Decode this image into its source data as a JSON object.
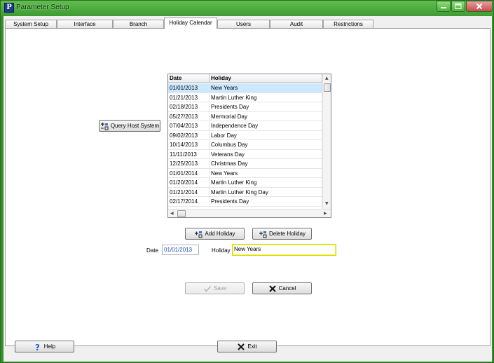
{
  "window": {
    "title": "Parameter Setup",
    "app_icon": "app-icon"
  },
  "tabs": [
    {
      "label": "System Setup"
    },
    {
      "label": "Interface"
    },
    {
      "label": "Branch"
    },
    {
      "label": "Holiday Calendar",
      "active": true
    },
    {
      "label": "Users"
    },
    {
      "label": "Audit"
    },
    {
      "label": "Restrictions"
    }
  ],
  "query_button": {
    "label": "Query Host System",
    "icon": "query-icon"
  },
  "grid": {
    "columns": {
      "date": "Date",
      "holiday": "Holiday"
    },
    "rows": [
      {
        "date": "01/01/2013",
        "holiday": "New Years"
      },
      {
        "date": "01/21/2013",
        "holiday": "Martin Luther King"
      },
      {
        "date": "02/18/2013",
        "holiday": "Presidents Day"
      },
      {
        "date": "05/27/2013",
        "holiday": "Mermorial Day"
      },
      {
        "date": "07/04/2013",
        "holiday": "Independence Day"
      },
      {
        "date": "09/02/2013",
        "holiday": "Labor Day"
      },
      {
        "date": "10/14/2013",
        "holiday": "Columbus Day"
      },
      {
        "date": "11/11/2013",
        "holiday": "Veterans Day"
      },
      {
        "date": "12/25/2013",
        "holiday": "Christmas Day"
      },
      {
        "date": "01/01/2014",
        "holiday": "New Years"
      },
      {
        "date": "01/20/2014",
        "holiday": "Martin Luther King"
      },
      {
        "date": "01/21/2014",
        "holiday": "Martin Luther King Day"
      },
      {
        "date": "02/17/2014",
        "holiday": "Presidents Day"
      }
    ],
    "selected_index": 0
  },
  "actions": {
    "add_label": "Add Holiday",
    "delete_label": "Delete Holiday"
  },
  "form": {
    "date_label": "Date",
    "date_value": "01/01/2013",
    "holiday_label": "Holiday",
    "holiday_value": "New Years"
  },
  "edit_buttons": {
    "save_label": "Save",
    "cancel_label": "Cancel"
  },
  "footer": {
    "help_label": "Help",
    "exit_label": "Exit"
  },
  "colors": {
    "title_bar": "#3f9a34",
    "selection": "#cce8ff",
    "focus_border": "#d8d800"
  }
}
